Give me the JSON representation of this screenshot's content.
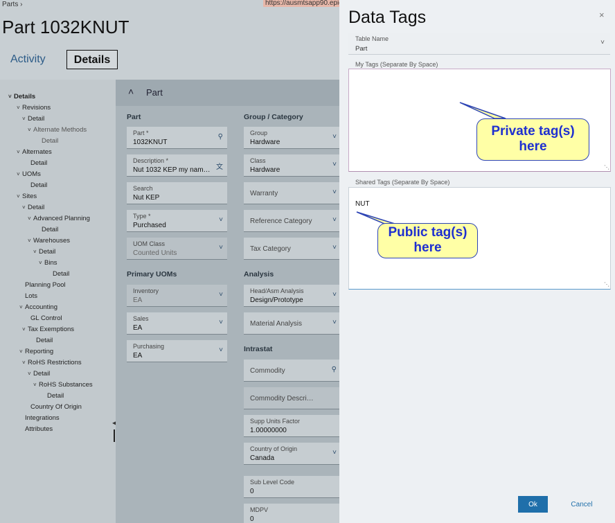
{
  "background": {
    "breadcrumb": "Parts  ›",
    "url": "https://ausmtsapp90.epico",
    "title": "Part 1032KNUT",
    "tabs": {
      "activity": "Activity",
      "details": "Details"
    },
    "tree": [
      {
        "label": "Details",
        "chev": "˅"
      },
      {
        "label": "Revisions",
        "chev": "˅"
      },
      {
        "label": "Detail",
        "chev": "˅"
      },
      {
        "label": "Alternate Methods",
        "chev": "˅"
      },
      {
        "label": "Detail",
        "chev": ""
      },
      {
        "label": "Alternates",
        "chev": "˅"
      },
      {
        "label": "Detail",
        "chev": ""
      },
      {
        "label": "UOMs",
        "chev": "˅"
      },
      {
        "label": "Detail",
        "chev": ""
      },
      {
        "label": "Sites",
        "chev": "˅"
      },
      {
        "label": "Detail",
        "chev": "˅"
      },
      {
        "label": "Advanced Planning",
        "chev": "˅"
      },
      {
        "label": "Detail",
        "chev": ""
      },
      {
        "label": "Warehouses",
        "chev": "˅"
      },
      {
        "label": "Detail",
        "chev": "˅"
      },
      {
        "label": "Bins",
        "chev": "˅"
      },
      {
        "label": "Detail",
        "chev": ""
      },
      {
        "label": "Planning Pool",
        "chev": ""
      },
      {
        "label": "Lots",
        "chev": ""
      },
      {
        "label": "Accounting",
        "chev": "˅"
      },
      {
        "label": "GL Control",
        "chev": ""
      },
      {
        "label": "Tax Exemptions",
        "chev": "˅"
      },
      {
        "label": "Detail",
        "chev": ""
      },
      {
        "label": "Reporting",
        "chev": "˅"
      },
      {
        "label": "RoHS Restrictions",
        "chev": "˅"
      },
      {
        "label": "Detail",
        "chev": "˅"
      },
      {
        "label": "RoHS Substances",
        "chev": "˅"
      },
      {
        "label": "Detail",
        "chev": ""
      },
      {
        "label": "Country Of Origin",
        "chev": ""
      },
      {
        "label": "Integrations",
        "chev": ""
      },
      {
        "label": "Attributes",
        "chev": ""
      }
    ],
    "section": {
      "label": "Part",
      "chev": "˄"
    },
    "groups": {
      "part": "Part",
      "group_category": "Group / Category",
      "primary_uoms": "Primary UOMs",
      "analysis": "Analysis",
      "intrastat": "Intrastat"
    },
    "fields": {
      "part": {
        "label": "Part *",
        "value": "1032KNUT"
      },
      "description": {
        "label": "Description *",
        "value": "Nut 1032 KEP my nam…"
      },
      "search": {
        "label": "Search",
        "value": "Nut KEP"
      },
      "type": {
        "label": "Type *",
        "value": "Purchased"
      },
      "uom_class": {
        "label": "UOM Class",
        "value": "Counted Units"
      },
      "inventory": {
        "label": "Inventory",
        "value": "EA"
      },
      "sales": {
        "label": "Sales",
        "value": "EA"
      },
      "purchasing": {
        "label": "Purchasing",
        "value": "EA"
      },
      "group": {
        "label": "Group",
        "value": "Hardware"
      },
      "class": {
        "label": "Class",
        "value": "Hardware"
      },
      "warranty": {
        "label": "Warranty"
      },
      "reference_category": {
        "label": "Reference Category"
      },
      "tax_category": {
        "label": "Tax Category"
      },
      "head_asm": {
        "label": "Head/Asm Analysis",
        "value": "Design/Prototype"
      },
      "material_analysis": {
        "label": "Material Analysis"
      },
      "commodity": {
        "label": "Commodity"
      },
      "commodity_desc": {
        "label": "Commodity Descri…"
      },
      "supp_units": {
        "label": "Supp Units Factor",
        "value": "1.00000000"
      },
      "country_origin": {
        "label": "Country of Origin",
        "value": "Canada"
      },
      "sub_level": {
        "label": "Sub Level Code",
        "value": "0"
      },
      "mdpv": {
        "label": "MDPV",
        "value": "0"
      }
    }
  },
  "panel": {
    "title": "Data Tags",
    "close_icon": "×",
    "table_name": {
      "label": "Table Name",
      "value": "Part",
      "chev": "˅"
    },
    "my_tags": {
      "label": "My Tags (Separate By Space)",
      "value": ""
    },
    "shared_tags": {
      "label": "Shared Tags (Separate By Space)",
      "value": "NUT"
    },
    "callouts": {
      "private": "Private tag(s) here",
      "public": "Public tag(s) here"
    },
    "buttons": {
      "ok": "Ok",
      "cancel": "Cancel"
    },
    "colors": {
      "accent": "#1f6faa",
      "callout_fill": "#ffffa6",
      "callout_text": "#1e2fd0"
    }
  }
}
